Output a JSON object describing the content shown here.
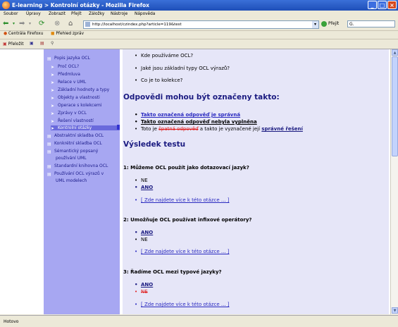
{
  "window": {
    "title": "E-learning > Kontrolní otázky - Mozilla Firefox"
  },
  "menu": [
    "Soubor",
    "Úpravy",
    "Zobrazit",
    "Přejít",
    "Záložky",
    "Nástroje",
    "Nápověda"
  ],
  "nav": {
    "url": "http://localhost/czindex.php?article=119&test",
    "go_label": "Přejít",
    "search_value": "G."
  },
  "bookmarks": [
    "Centrála Firefoxu",
    "Přehled zpráv"
  ],
  "toolbar2": {
    "label": "Přeložit"
  },
  "sidebar": {
    "items": [
      "Popis jazyka OCL",
      "Proč OCL?",
      "Předmluva",
      "Relace v UML",
      "Základní hodnoty a typy",
      "Objekty a vlastnosti",
      "Operace s kolekcemi",
      "Zprávy v OCL",
      "Řešení vlastností",
      "Kontrolní otázky",
      "Abstraktní skladba OCL",
      "Konkrétní skladba OCL",
      "Sémantický popsaný",
      "používání UML",
      "Standardní knihovna OCL",
      "Používání OCL výrazů v",
      "UML modelech"
    ]
  },
  "main": {
    "intro_bullets": [
      "Kde používáme OCL?",
      "Jaké jsou základní typy OCL výrazů?",
      "Co je to kolekce?"
    ],
    "marking_heading": "Odpovědi mohou být označeny takto:",
    "marking": {
      "correct": "Takto označená odpověď je správná",
      "unfilled": "Takto označená odpověď nebyla vyplněna",
      "wrong_prefix": "Toto je",
      "wrong_word": "špatná odpověď",
      "wrong_middle": "a takto je vyznačené její",
      "wrong_solution": "správné řešení"
    },
    "result_heading": "Výsledek testu",
    "questions": [
      {
        "q": "1: Můžeme OCL použít jako dotazovací jazyk?",
        "answers": [
          "NE",
          "ANO"
        ],
        "link": "[ Zde najdete více k této otázce ... ]"
      },
      {
        "q": "2: Umožňuje OCL používat infixové operátory?",
        "answers": [
          "ANO",
          "NE"
        ],
        "link": "[ Zde najdete více k této otázce ... ]"
      },
      {
        "q": "3: Řadíme OCL mezi typové jazyky?",
        "answers": [
          "ANO",
          "NE"
        ],
        "link": "[ Zde najdete více k této otázce ... ]"
      }
    ]
  },
  "status": {
    "text": "Hotovo"
  },
  "colors": {
    "sidebar_bg": "#A7A7F2",
    "main_bg": "#E6E6F8",
    "heading": "#1A1A80",
    "wrong": "#E02020"
  }
}
